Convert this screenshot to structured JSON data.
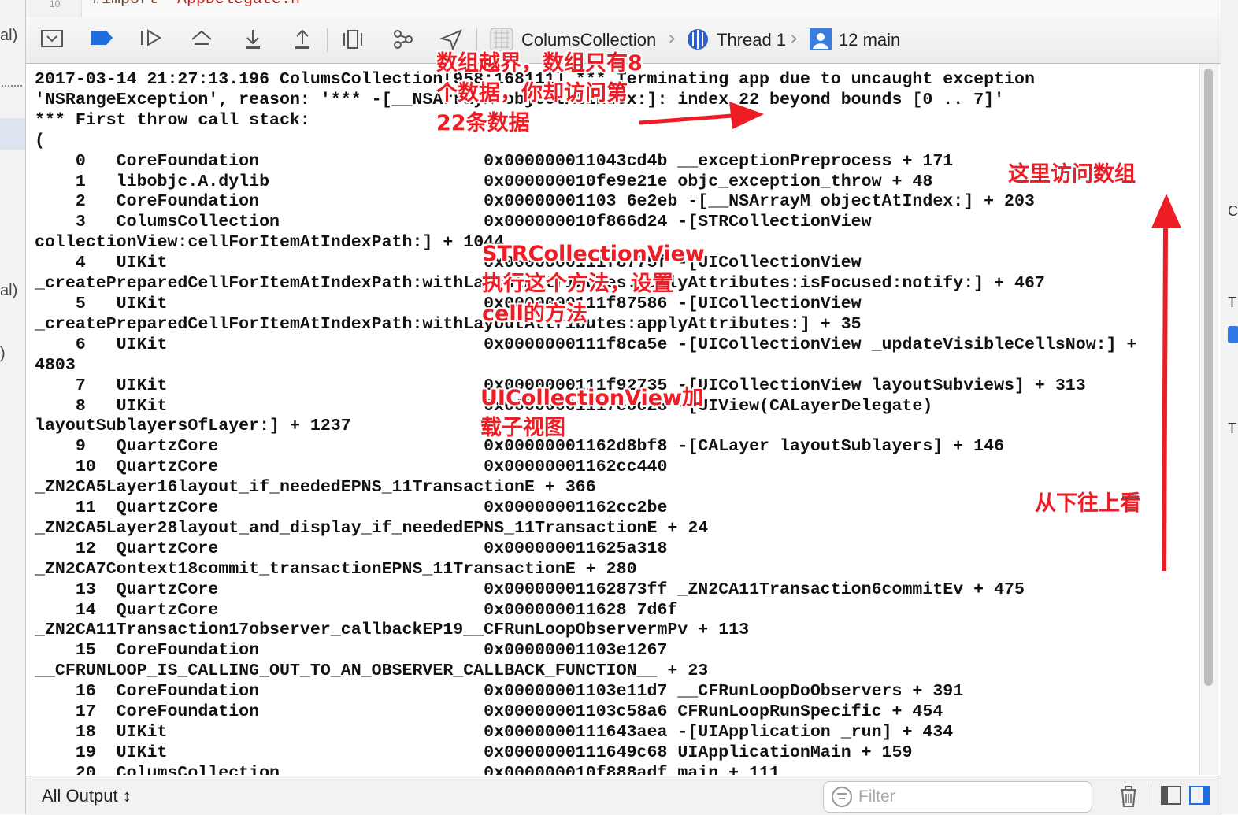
{
  "editor": {
    "line_number": "10",
    "code_keyword": "#import",
    "code_string": " \"AppDelegate.h\""
  },
  "left_pane": {
    "fragments": [
      "al)",
      "al)",
      ")"
    ]
  },
  "right_pane": {
    "fragments": [
      "C",
      "T",
      "T"
    ]
  },
  "debug_bar": {
    "icons": [
      "hide-console-icon",
      "breakpoints-toggle-icon",
      "continue-icon",
      "step-over-icon",
      "step-into-icon",
      "step-out-icon",
      "view-debugger-icon",
      "memory-graph-icon",
      "simulate-location-icon"
    ],
    "breadcrumb": {
      "target": "ColumsCollection",
      "thread": "Thread 1",
      "frame": "12 main"
    }
  },
  "console": {
    "lines": [
      "2017-03-14 21:27:13.196 ColumsCollection[958:168111] *** Terminating app due to uncaught exception",
      "'NSRangeException', reason: '*** -[__NSArrayM objectAtIndex:]: index 22 beyond bounds [0 .. 7]'",
      "*** First throw call stack:",
      "(",
      "    0   CoreFoundation                      0x000000011043cd4b __exceptionPreprocess + 171",
      "    1   libobjc.A.dylib                     0x000000010fe9e21e objc_exception_throw + 48",
      "    2   CoreFoundation                      0x00000001103 6e2eb -[__NSArrayM objectAtIndex:] + 203",
      "    3   ColumsCollection                    0x000000010f866d24 -[STRCollectionView",
      "collectionView:cellForItemAtIndexPath:] + 1044",
      "    4   UIKit                               0x0000000111f8775f -[UICollectionView",
      "_createPreparedCellForItemAtIndexPath:withLayoutAttributes:applyAttributes:isFocused:notify:] + 467",
      "    5   UIKit                               0x0000000111f87586 -[UICollectionView",
      "_createPreparedCellForItemAtIndexPath:withLayoutAttributes:applyAttributes:] + 35",
      "    6   UIKit                               0x0000000111f8ca5e -[UICollectionView _updateVisibleCellsNow:] +",
      "4803",
      "    7   UIKit                               0x0000000111f92735 -[UICollectionView layoutSubviews] + 313",
      "    8   UIKit                               0x00000001117e0c28 -[UIView(CALayerDelegate)",
      "layoutSublayersOfLayer:] + 1237",
      "    9   QuartzCore                          0x00000001162d8bf8 -[CALayer layoutSublayers] + 146",
      "    10  QuartzCore                          0x00000001162cc440",
      "_ZN2CA5Layer16layout_if_neededEPNS_11TransactionE + 366",
      "    11  QuartzCore                          0x00000001162cc2be",
      "_ZN2CA5Layer28layout_and_display_if_neededEPNS_11TransactionE + 24",
      "    12  QuartzCore                          0x000000011625a318",
      "_ZN2CA7Context18commit_transactionEPNS_11TransactionE + 280",
      "    13  QuartzCore                          0x00000001162873ff _ZN2CA11Transaction6commitEv + 475",
      "    14  QuartzCore                          0x000000011628 7d6f",
      "_ZN2CA11Transaction17observer_callbackEP19__CFRunLoopObservermPv + 113",
      "    15  CoreFoundation                      0x00000001103e1267",
      "__CFRUNLOOP_IS_CALLING_OUT_TO_AN_OBSERVER_CALLBACK_FUNCTION__ + 23",
      "    16  CoreFoundation                      0x00000001103e11d7 __CFRunLoopDoObservers + 391",
      "    17  CoreFoundation                      0x00000001103c58a6 CFRunLoopRunSpecific + 454",
      "    18  UIKit                               0x0000000111643aea -[UIApplication _run] + 434",
      "    19  UIKit                               0x0000000111649c68 UIApplicationMain + 159",
      "    20  ColumsCollection                    0x000000010f888adf main + 111"
    ]
  },
  "annotations": {
    "out_of_bounds": [
      "数组越界，数组只有8",
      "个数据，你却访问第",
      "22条数据"
    ],
    "access_array": "这里访问数组",
    "cell_method": [
      "STRCollectionView",
      "执行这个方法，设置",
      "cell的方法"
    ],
    "load_subviews": [
      "UICollectionView加",
      "载子视图"
    ],
    "read_bottom_up": "从下往上看",
    "color": "#ee1c25"
  },
  "bottom_bar": {
    "output_selector": "All Output ↕",
    "filter_placeholder": "Filter"
  },
  "colors": {
    "accent_blue": "#1d6fe0",
    "toolbar_bg": "#ececec"
  }
}
